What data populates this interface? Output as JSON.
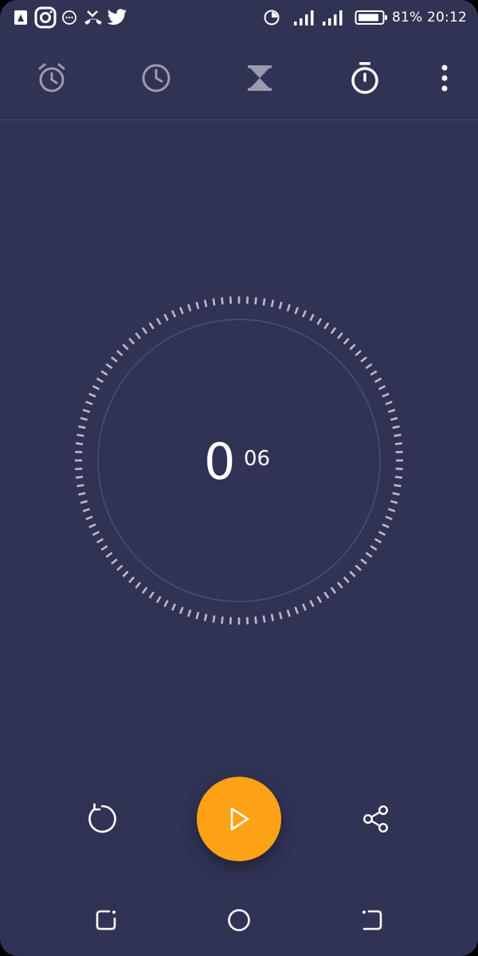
{
  "status_bar": {
    "battery_percent": "81%",
    "time": "20:12",
    "notification_icons": [
      "app-drawer-icon",
      "instagram-icon",
      "message-icon",
      "missed-call-icon",
      "twitter-icon"
    ],
    "system_icons": [
      "data-saver-icon",
      "signal-icon",
      "signal-icon",
      "battery-icon"
    ]
  },
  "tabs": [
    {
      "name": "alarm",
      "icon": "alarm-clock-icon",
      "active": false
    },
    {
      "name": "clock",
      "icon": "clock-icon",
      "active": false
    },
    {
      "name": "timer",
      "icon": "hourglass-icon",
      "active": false
    },
    {
      "name": "stopwatch",
      "icon": "stopwatch-icon",
      "active": true
    }
  ],
  "stopwatch": {
    "seconds": "0",
    "hundredths": "06"
  },
  "controls": {
    "reset_icon": "reset-icon",
    "play_icon": "play-icon",
    "share_icon": "share-icon"
  },
  "colors": {
    "background": "#303354",
    "accent": "#fca214",
    "icon_inactive": "#9a9cb0",
    "icon_active": "#ffffff",
    "dial_ticks": "#b9bbc8",
    "dial_inner_ring": "#4d5073"
  }
}
